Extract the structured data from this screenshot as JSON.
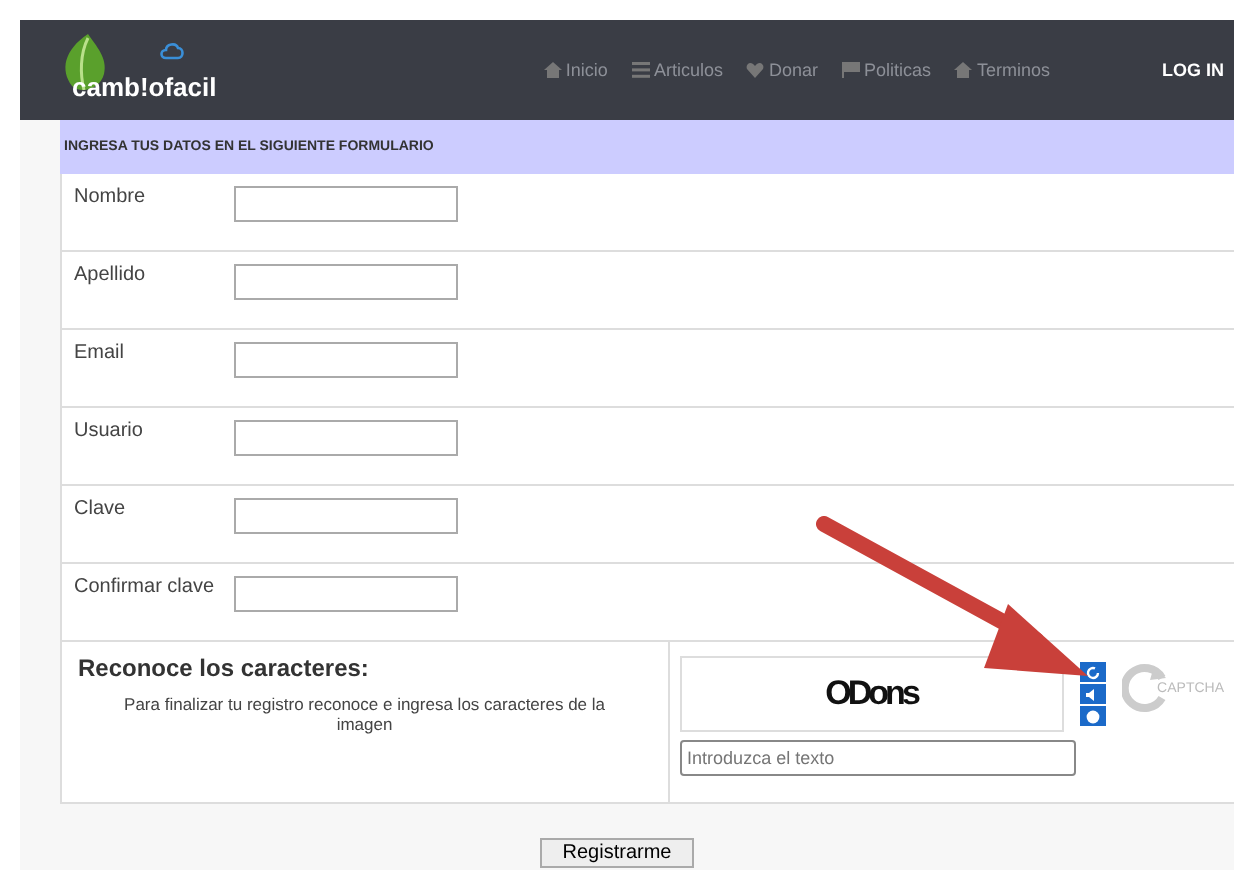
{
  "header": {
    "logo": "camb!ofacil",
    "nav": [
      {
        "label": "Inicio",
        "kind": "home"
      },
      {
        "label": "Articulos",
        "kind": "list"
      },
      {
        "label": "Donar",
        "kind": "heart"
      },
      {
        "label": "Politicas",
        "kind": "flag"
      },
      {
        "label": "Terminos",
        "kind": "home"
      }
    ],
    "login": "LOG IN"
  },
  "form": {
    "title": "INGRESA TUS DATOS EN EL SIGUIENTE FORMULARIO",
    "fields": [
      {
        "label": "Nombre"
      },
      {
        "label": "Apellido"
      },
      {
        "label": "Email"
      },
      {
        "label": "Usuario"
      },
      {
        "label": "Clave"
      },
      {
        "label": "Confirmar clave"
      }
    ]
  },
  "captcha": {
    "heading": "Reconoce los caracteres:",
    "instructions": "Para finalizar tu registro reconoce e ingresa los caracteres de la imagen",
    "challenge": "ODons",
    "placeholder": "Introduzca el texto",
    "brand": "CAPTCHA"
  },
  "submit": "Registrarme"
}
